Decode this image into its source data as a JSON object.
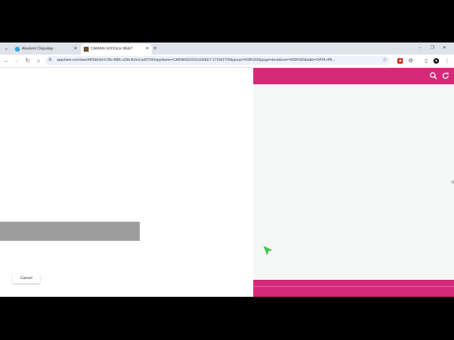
{
  "browser": {
    "tabs": [
      {
        "label": "Akademi CikguApp",
        "active": false,
        "favicon_color": "#3aa6dd"
      },
      {
        "label": "CARIAN GOOGLE MEET",
        "active": true,
        "favicon_color": "#6d4c2f"
      }
    ],
    "new_tab_icon": "plus-icon",
    "window_controls": {
      "minimize": "–",
      "restore": "❐",
      "close": "✕"
    },
    "address_bar": {
      "url": "appsheet.com/start/4f65b64d-678b-4886-a39d-fb2e1ca00795#appName=CARIANGOOGLEMEET-271842705&group=%5B%5D&page=deck&sort=%5B%5D&table=DATA+PA..."
    }
  },
  "dialog": {
    "cancel_label": "Cancel"
  },
  "app": {
    "accent_color": "#d42a78",
    "header_icons": [
      "search-icon",
      "refresh-icon"
    ],
    "edge_text": "N"
  }
}
